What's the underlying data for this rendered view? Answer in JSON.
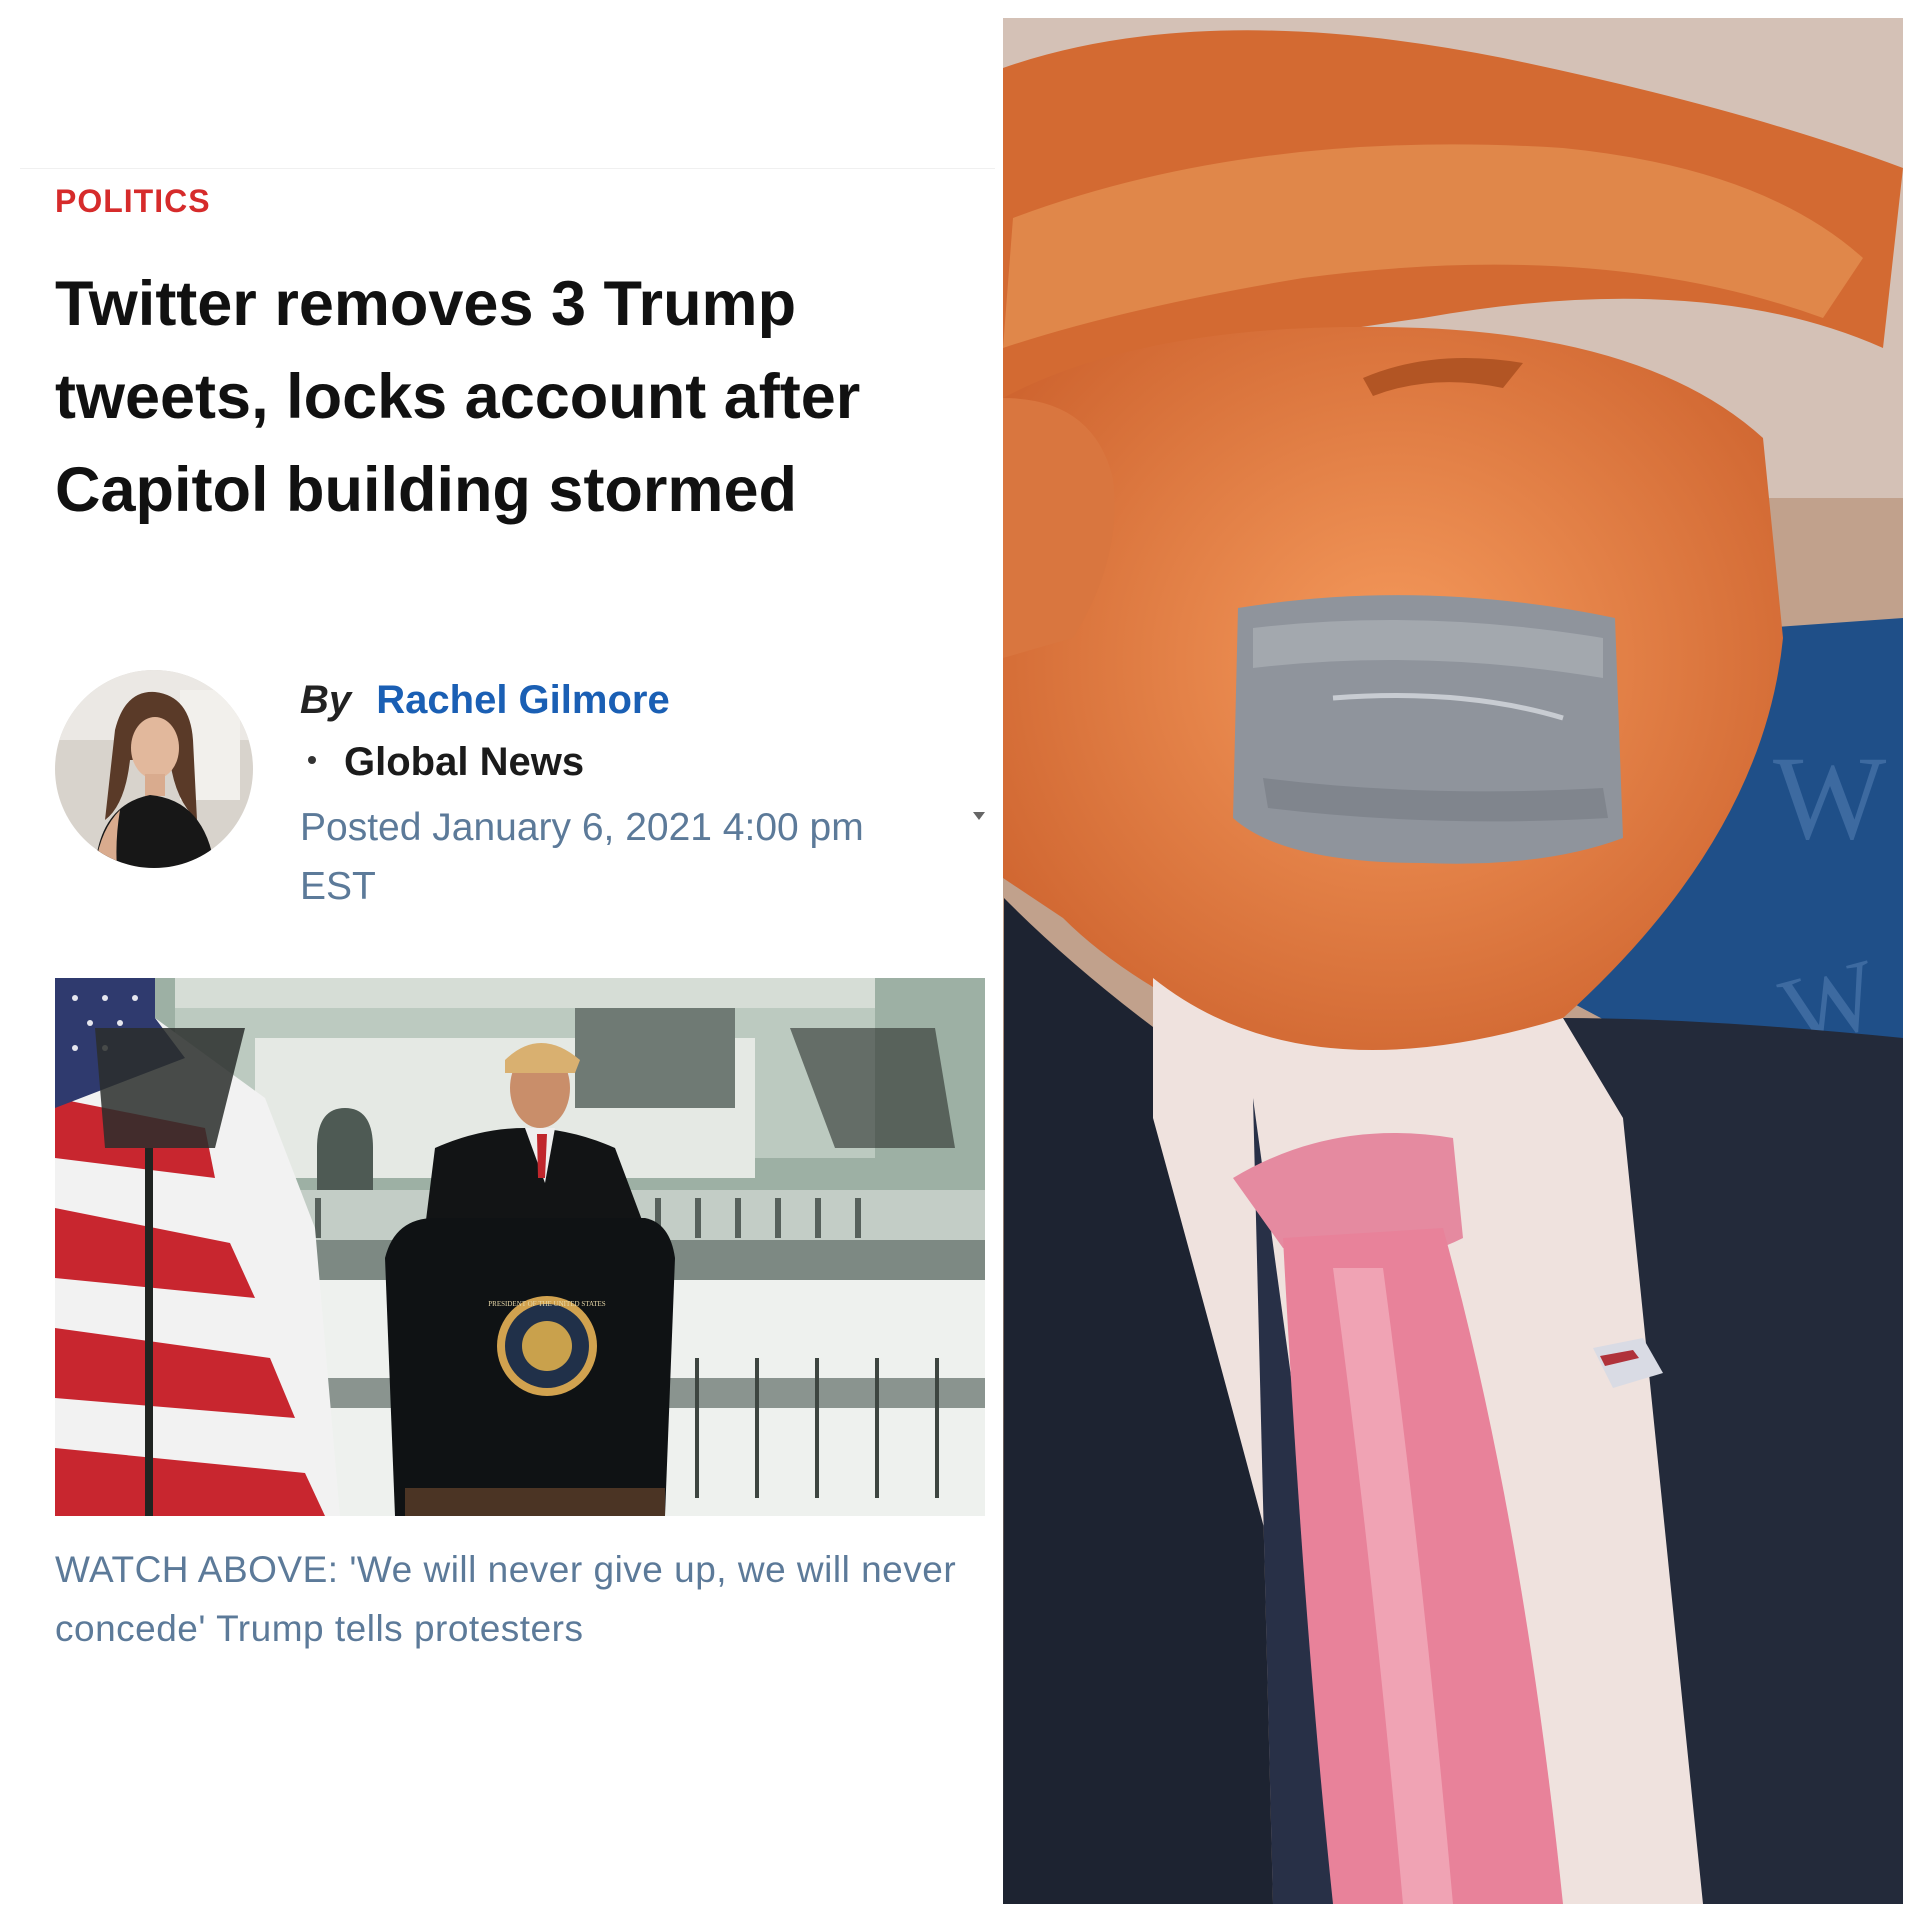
{
  "article": {
    "category": "POLITICS",
    "headline": "Twitter removes 3 Trump tweets, locks account after Capitol building stormed",
    "byline": {
      "by_label": "By",
      "author": "Rachel Gilmore",
      "outlet": "Global News",
      "posted": "Posted January 6, 2021 4:00 pm EST"
    },
    "video": {
      "seal_text": "PRESIDENT OF THE UNITED STATES",
      "caption": "WATCH ABOVE: 'We will never give up, we will never concede' Trump tells protesters"
    }
  },
  "photo": {
    "background_text": "W"
  },
  "colors": {
    "category_red": "#d62b2b",
    "link_blue": "#1a5fb4",
    "meta_blue_gray": "#5c7a99",
    "tie_pink": "#e8829a",
    "tape_gray": "#8f949c"
  }
}
